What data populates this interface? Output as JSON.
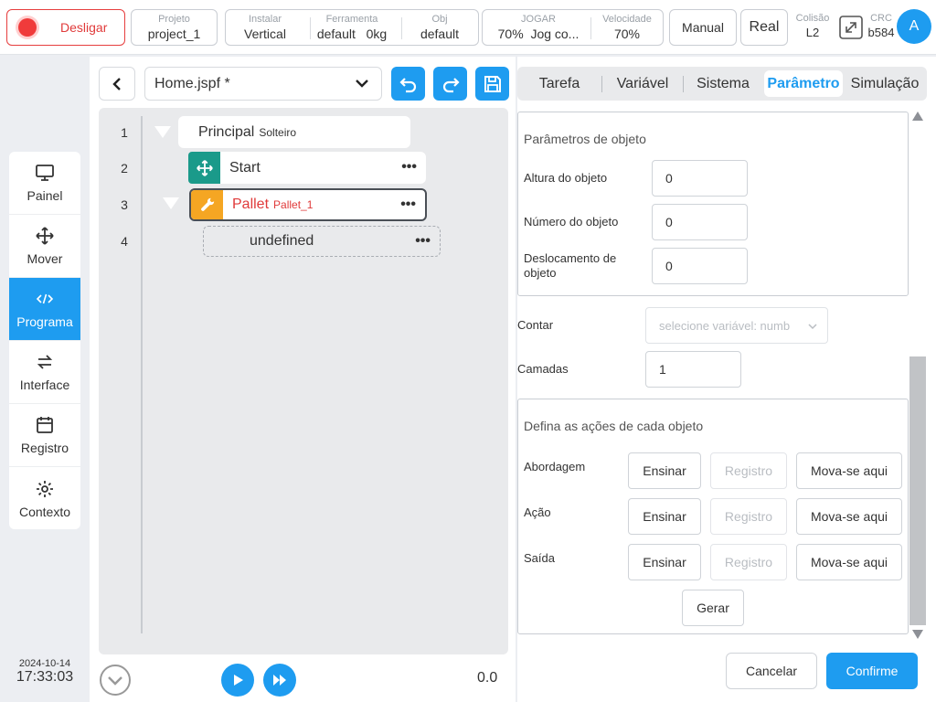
{
  "topbar": {
    "power_label": "Desligar",
    "project_key": "Projeto",
    "project_value": "project_1",
    "install_key": "Instalar",
    "install_value": "Vertical",
    "tool_key": "Ferramenta",
    "tool_value": "default",
    "tool_weight": "0kg",
    "obj_key": "Obj",
    "obj_value": "default",
    "jog_key": "JOGAR",
    "jog_value": "70%",
    "jog_mode": "Jog co...",
    "speed_key": "Velocidade",
    "speed_value": "70%",
    "manual_label": "Manual",
    "real_label": "Real",
    "collision_key": "Colisão",
    "collision_value": "L2",
    "crc_key": "CRC",
    "crc_value": "b584",
    "avatar_letter": "A"
  },
  "sidebar": {
    "items": [
      {
        "label": "Painel",
        "icon": "monitor-icon"
      },
      {
        "label": "Mover",
        "icon": "move-icon"
      },
      {
        "label": "Programa",
        "icon": "code-icon"
      },
      {
        "label": "Interface",
        "icon": "swap-icon"
      },
      {
        "label": "Registro",
        "icon": "calendar-icon"
      },
      {
        "label": "Contexto",
        "icon": "gear-icon"
      }
    ],
    "active": "Programa"
  },
  "datetime": {
    "date": "2024-10-14",
    "time": "17:33:03"
  },
  "editor": {
    "file_name": "Home.jspf *",
    "lines": [
      {
        "num": "1",
        "name": "Principal",
        "sub": "Solteiro"
      },
      {
        "num": "2",
        "name": "Start",
        "sub": ""
      },
      {
        "num": "3",
        "name": "Pallet",
        "sub": "Pallet_1"
      },
      {
        "num": "4",
        "name": "undefined",
        "sub": ""
      }
    ],
    "more_glyph": "•••",
    "speed_readout": "0.0"
  },
  "tabs": [
    "Tarefa",
    "Variável",
    "Sistema",
    "Parâmetro",
    "Simulação"
  ],
  "active_tab": "Parâmetro",
  "params": {
    "object_group_title": "Parâmetros de objeto",
    "height_label": "Altura do objeto",
    "height_value": "0",
    "number_label": "Número do objeto",
    "number_value": "0",
    "offset_label": "Deslocamento de objeto",
    "offset_value": "0",
    "count_label": "Contar",
    "count_placeholder": "selecione variável: numb",
    "layers_label": "Camadas",
    "layers_value": "1",
    "actions_group_title": "Defina as ações de cada objeto",
    "rows": [
      {
        "label": "Abordagem"
      },
      {
        "label": "Ação"
      },
      {
        "label": "Saída"
      }
    ],
    "teach_label": "Ensinar",
    "record_label": "Registro",
    "move_label": "Mova-se aqui",
    "generate_label": "Gerar"
  },
  "footer": {
    "cancel_label": "Cancelar",
    "confirm_label": "Confirme"
  },
  "colors": {
    "accent": "#1e9cf0",
    "danger": "#e63e3e",
    "start_node": "#1a9a8a",
    "pallet_node": "#f5a623"
  }
}
